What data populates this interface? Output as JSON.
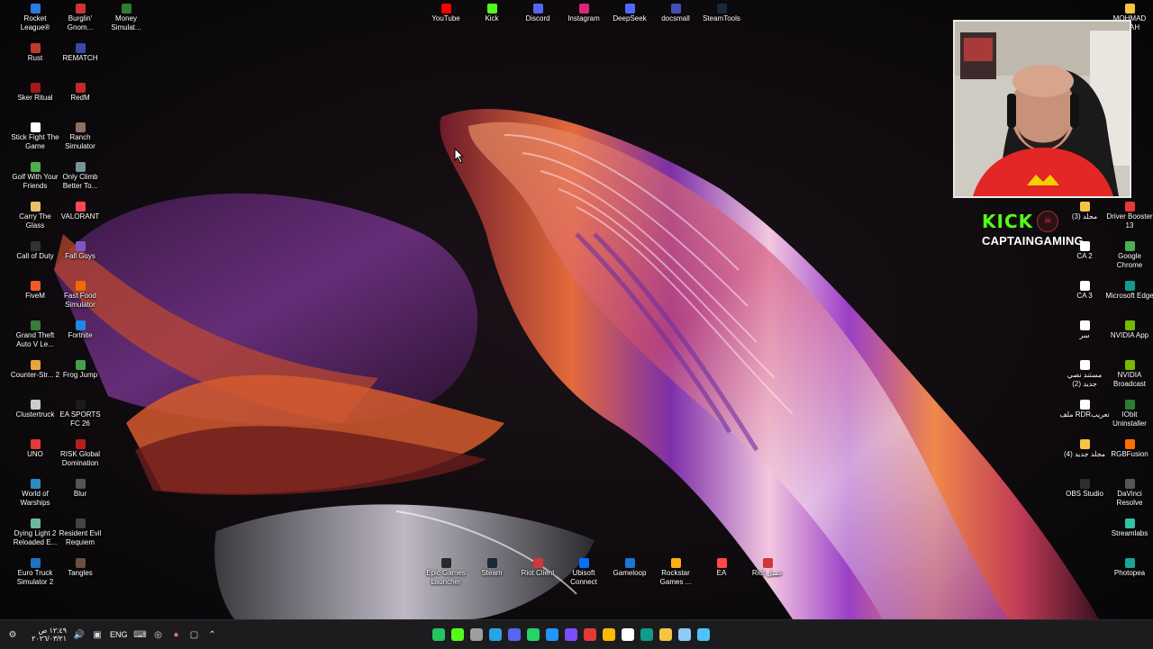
{
  "desktop": {
    "left_column": [
      {
        "label": "Rocket League®",
        "icon": "rocket-league-icon",
        "color": "#2a7de1"
      },
      {
        "label": "Rust",
        "icon": "rust-icon",
        "color": "#c0392b"
      },
      {
        "label": "Sker Ritual",
        "icon": "sker-ritual-icon",
        "color": "#a01a1a"
      },
      {
        "label": "Stick Fight The Game",
        "icon": "stick-fight-icon",
        "color": "#ffffff"
      },
      {
        "label": "Golf With Your Friends",
        "icon": "golf-icon",
        "color": "#4caf50"
      },
      {
        "label": "Carry The Glass",
        "icon": "carry-glass-icon",
        "color": "#e6c16a"
      },
      {
        "label": "Call of Duty",
        "icon": "call-of-duty-icon",
        "color": "#333333"
      },
      {
        "label": "FiveM",
        "icon": "fivem-icon",
        "color": "#f05a28"
      },
      {
        "label": "Grand Theft Auto V Le...",
        "icon": "gta-icon",
        "color": "#3a7a3a"
      },
      {
        "label": "Counter-Str... 2",
        "icon": "counter-strike-icon",
        "color": "#e8a33b"
      },
      {
        "label": "Clustertruck",
        "icon": "clustertruck-icon",
        "color": "#cccccc"
      },
      {
        "label": "UNO",
        "icon": "uno-icon",
        "color": "#e53935"
      },
      {
        "label": "World of Warships",
        "icon": "world-of-warships-icon",
        "color": "#2e8bc0"
      },
      {
        "label": "Dying Light 2 Reloaded E...",
        "icon": "dying-light-icon",
        "color": "#6fb7a0"
      },
      {
        "label": "Euro Truck Simulator 2",
        "icon": "euro-truck-icon",
        "color": "#1e73be"
      }
    ],
    "second_column": [
      {
        "label": "Burglin' Gnom...",
        "icon": "burglin-gnomes-icon",
        "color": "#cc3333"
      },
      {
        "label": "REMATCH",
        "icon": "rematch-icon",
        "color": "#3949ab"
      },
      {
        "label": "RedM",
        "icon": "redm-icon",
        "color": "#c62828"
      },
      {
        "label": "Ranch Simulator",
        "icon": "ranch-simulator-icon",
        "color": "#8d6e63"
      },
      {
        "label": "Only Climb Better To...",
        "icon": "only-climb-icon",
        "color": "#78909c"
      },
      {
        "label": "VALORANT",
        "icon": "valorant-icon",
        "color": "#ff4655"
      },
      {
        "label": "Fall Guys",
        "icon": "fall-guys-icon",
        "color": "#7e57c2"
      },
      {
        "label": "Fast Food Simulator",
        "icon": "fast-food-icon",
        "color": "#ef6c00"
      },
      {
        "label": "Fortnite",
        "icon": "fortnite-icon",
        "color": "#1e88e5"
      },
      {
        "label": "Frog Jump",
        "icon": "frog-jump-icon",
        "color": "#43a047"
      },
      {
        "label": "EA SPORTS FC 26",
        "icon": "ea-fc-icon",
        "color": "#1b1b1b"
      },
      {
        "label": "RISK Global Domination",
        "icon": "risk-icon",
        "color": "#b71c1c"
      },
      {
        "label": "Blur",
        "icon": "blur-icon",
        "color": "#555555"
      },
      {
        "label": "Resident Evil Requiem",
        "icon": "resident-evil-icon",
        "color": "#444444"
      },
      {
        "label": "Tangles",
        "icon": "tangles-icon",
        "color": "#6d4c41"
      }
    ],
    "third_column": [
      {
        "label": "Money Simulat...",
        "icon": "money-simulator-icon",
        "color": "#2e7d32"
      }
    ],
    "top_row": [
      {
        "label": "YouTube",
        "icon": "youtube-icon",
        "color": "#ff0000"
      },
      {
        "label": "Kick",
        "icon": "kick-icon",
        "color": "#53fc18"
      },
      {
        "label": "Discord",
        "icon": "discord-icon",
        "color": "#5865f2"
      },
      {
        "label": "Instagram",
        "icon": "instagram-icon",
        "color": "#d62976"
      },
      {
        "label": "DeepSeek",
        "icon": "deepseek-icon",
        "color": "#4d6bfe"
      },
      {
        "label": "docsmall",
        "icon": "docsmall-icon",
        "color": "#3f51b5"
      },
      {
        "label": "SteamTools",
        "icon": "steamtools-icon",
        "color": "#1b2838"
      }
    ],
    "bottom_row": [
      {
        "label": "Epic Games Launcher",
        "icon": "epic-games-icon",
        "color": "#2a2a2a"
      },
      {
        "label": "Steam",
        "icon": "steam-icon",
        "color": "#1b2838"
      },
      {
        "label": "Riot Client",
        "icon": "riot-client-icon",
        "color": "#d13639"
      },
      {
        "label": "Ubisoft Connect",
        "icon": "ubisoft-icon",
        "color": "#0070ff"
      },
      {
        "label": "Gameloop",
        "icon": "gameloop-icon",
        "color": "#1976d2"
      },
      {
        "label": "Rockstar Games ...",
        "icon": "rockstar-icon",
        "color": "#fcaf17"
      },
      {
        "label": "EA",
        "icon": "ea-icon",
        "color": "#ff4747"
      },
      {
        "label": "Riot عميل",
        "icon": "riot-icon",
        "color": "#d13639"
      }
    ],
    "right_inner_column": [
      {
        "label": "مجلد (3)",
        "icon": "folder-icon",
        "color": "#f6c343"
      },
      {
        "label": "CA 2",
        "icon": "file-icon",
        "color": "#ffffff"
      },
      {
        "label": "CA 3",
        "icon": "file-icon",
        "color": "#ffffff"
      },
      {
        "label": "سر",
        "icon": "file-icon",
        "color": "#ffffff"
      },
      {
        "label": "مستند نصي جديد (2)",
        "icon": "text-file-icon",
        "color": "#ffffff"
      },
      {
        "label": "ملف RDRتعريب",
        "icon": "file-icon",
        "color": "#ffffff"
      },
      {
        "label": "مجلد جديد (4)",
        "icon": "folder-icon",
        "color": "#f6c343"
      },
      {
        "label": "OBS Studio",
        "icon": "obs-icon",
        "color": "#302e31"
      }
    ],
    "right_outer_column": [
      {
        "label": "Driver Booster 13",
        "icon": "driver-booster-icon",
        "color": "#e53935"
      },
      {
        "label": "Google Chrome",
        "icon": "chrome-icon",
        "color": "#4caf50"
      },
      {
        "label": "Microsoft Edge",
        "icon": "edge-icon",
        "color": "#0f9d8a"
      },
      {
        "label": "NVIDIA App",
        "icon": "nvidia-app-icon",
        "color": "#76b900"
      },
      {
        "label": "NVIDIA Broadcast",
        "icon": "nvidia-broadcast-icon",
        "color": "#76b900"
      },
      {
        "label": "IObit Uninstaller",
        "icon": "iobit-icon",
        "color": "#2e7d32"
      },
      {
        "label": "RGBFusion",
        "icon": "rgbfusion-icon",
        "color": "#ff6f00"
      },
      {
        "label": "DaVinci Resolve",
        "icon": "davinci-icon",
        "color": "#555555"
      },
      {
        "label": "Streamlabs",
        "icon": "streamlabs-icon",
        "color": "#31c3a2"
      },
      {
        "label": "Photopea",
        "icon": "photopea-icon",
        "color": "#18a497"
      }
    ],
    "top_right_partial": [
      {
        "label": "MOHMAD ...FAH",
        "icon": "folder-icon",
        "color": "#f6c343"
      }
    ]
  },
  "overlay": {
    "kick_logo": "KICK",
    "channel_name": "CAPTAINGAMING"
  },
  "taskbar": {
    "clock_time": "١٢:٤٩ ص",
    "clock_date": "٢٠٢٦/٠٣/٢١",
    "language": "ENG",
    "apps": [
      {
        "icon": "play-icon",
        "color": "#22c55e"
      },
      {
        "icon": "kick-icon",
        "color": "#53fc18"
      },
      {
        "icon": "settings-icon",
        "color": "#9e9e9e"
      },
      {
        "icon": "telegram-icon",
        "color": "#2aa3e2"
      },
      {
        "icon": "discord-icon",
        "color": "#5865f2"
      },
      {
        "icon": "whatsapp-icon",
        "color": "#25d366"
      },
      {
        "icon": "shield-icon",
        "color": "#2196f3"
      },
      {
        "icon": "capcut-icon",
        "color": "#7c4dff"
      },
      {
        "icon": "record-icon",
        "color": "#e53935"
      },
      {
        "icon": "chrome-icon",
        "color": "#fbbc05"
      },
      {
        "icon": "store-icon",
        "color": "#ffffff"
      },
      {
        "icon": "edge-icon",
        "color": "#0f9d8a"
      },
      {
        "icon": "file-explorer-icon",
        "color": "#f6c343"
      },
      {
        "icon": "notepad-icon",
        "color": "#90caf9"
      },
      {
        "icon": "windows-start-icon",
        "color": "#4fc3f7"
      }
    ]
  }
}
